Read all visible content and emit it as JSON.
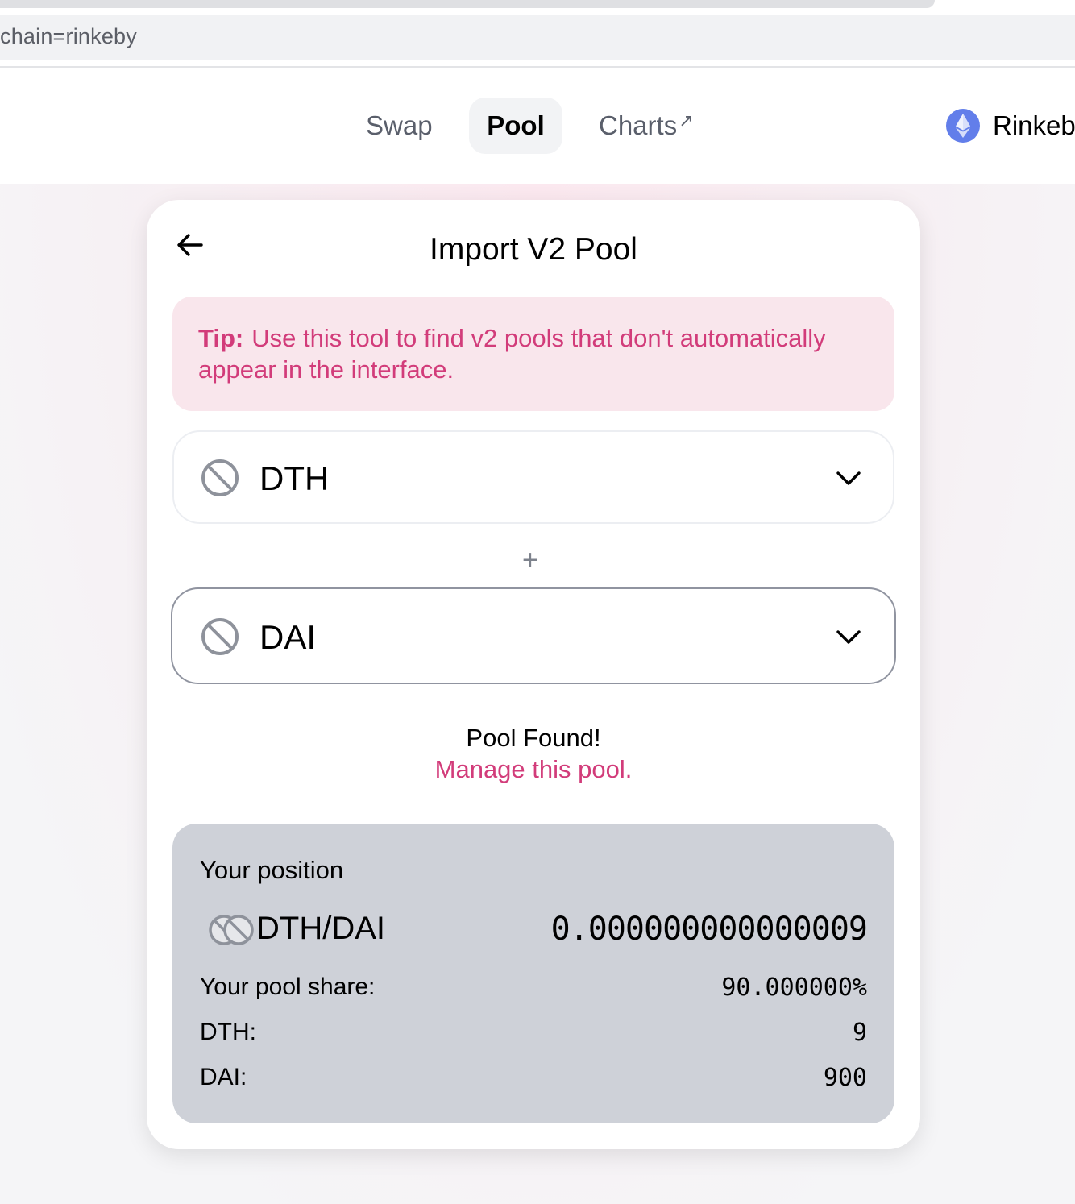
{
  "browser": {
    "url_fragment": "chain=rinkeby"
  },
  "nav": {
    "swap": "Swap",
    "pool": "Pool",
    "charts": "Charts",
    "charts_suffix": "↗",
    "network": "Rinkeb"
  },
  "card": {
    "title": "Import V2 Pool",
    "tip_label": "Tip:",
    "tip_text": "Use this tool to find v2 pools that don't automatically appear in the interface.",
    "token_a": "DTH",
    "token_b": "DAI",
    "plus": "+",
    "found": "Pool Found!",
    "manage": "Manage this pool."
  },
  "position": {
    "title": "Your position",
    "pair": "DTH/DAI",
    "balance": "0.000000000000009",
    "share_label": "Your pool share:",
    "share_value": "90.000000%",
    "token_a_label": "DTH:",
    "token_a_value": "9",
    "token_b_label": "DAI:",
    "token_b_value": "900"
  },
  "colors": {
    "accent": "#d23c7a",
    "tip_bg": "#f9e6ec",
    "position_bg": "#ced1d8",
    "eth_icon": "#627eea"
  },
  "icons": {
    "back": "arrow-left-icon",
    "token": "ban-icon",
    "chevron": "chevron-down-icon",
    "network": "ethereum-icon"
  }
}
